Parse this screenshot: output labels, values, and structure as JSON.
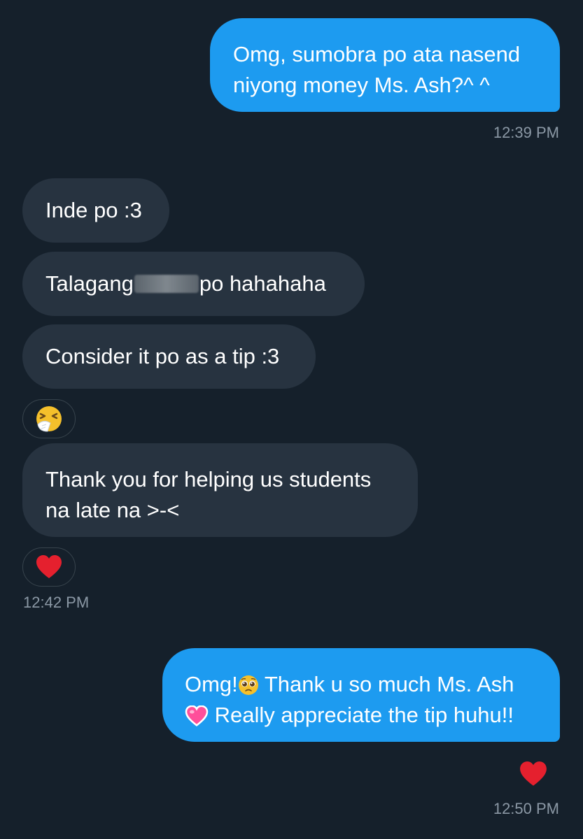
{
  "conversation": {
    "msg1": {
      "line1": "Omg, sumobra po ata nasend",
      "line2": "niyong money Ms. Ash?^ ^",
      "time": "12:39 PM"
    },
    "msg2": {
      "text": "Inde po :3"
    },
    "msg3": {
      "prefix": "Talagang",
      "suffix": "po hahahaha"
    },
    "msg4": {
      "text": "Consider it po as a tip :3"
    },
    "msg4_reaction": {
      "icon": "sneezing-face-emoji"
    },
    "msg5": {
      "line1": "Thank you for helping us students",
      "line2": "na late na >-<",
      "time": "12:42 PM"
    },
    "msg5_reaction": {
      "icon": "red-heart-emoji"
    },
    "msg6": {
      "line1_a": "Omg!",
      "line1_b": "Thank u so much Ms. Ash",
      "line2": "Really appreciate the tip huhu!!",
      "time": "12:50 PM"
    },
    "msg6_reaction": {
      "icon": "red-heart-emoji"
    }
  },
  "colors": {
    "background": "#15202b",
    "sent_bubble": "#1d9bf0",
    "received_bubble": "#273340",
    "timestamp": "#8b98a5"
  }
}
